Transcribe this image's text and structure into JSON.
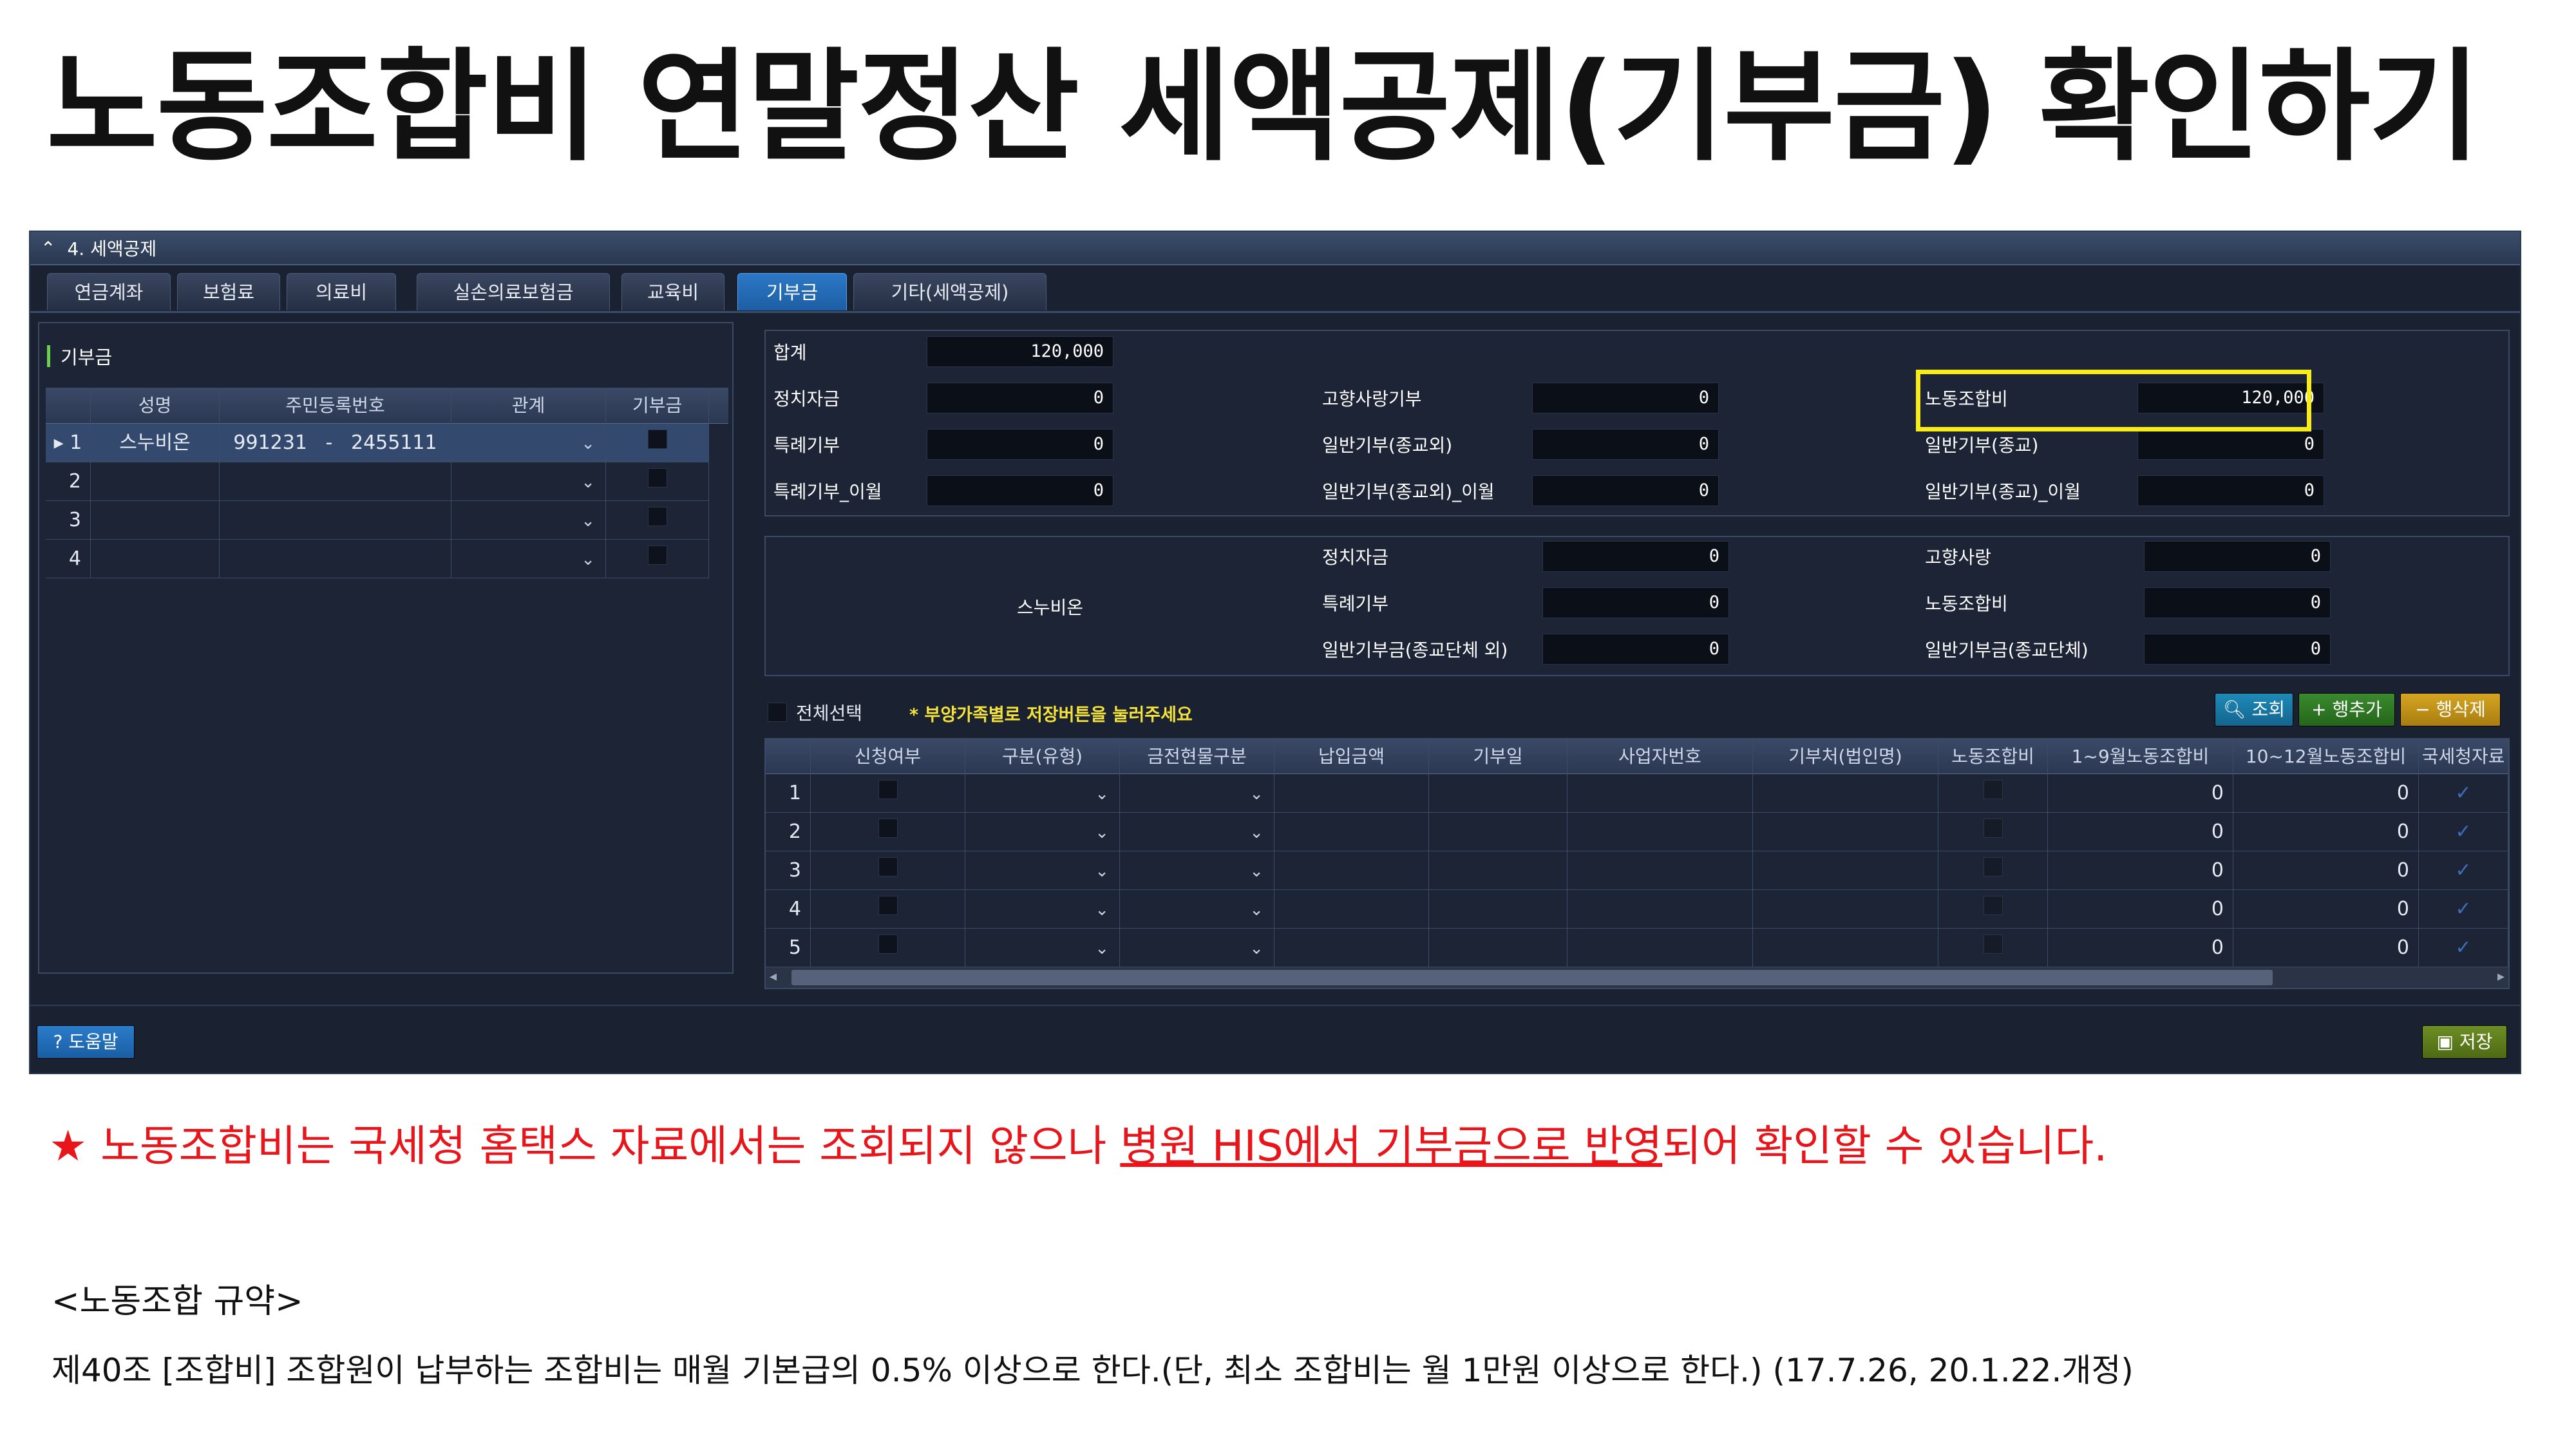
{
  "title": "노동조합비 연말정산 세액공제(기부금) 확인하기",
  "section": {
    "label": "4. 세액공제"
  },
  "tabs": [
    "연금계좌",
    "보험료",
    "의료비",
    "실손의료보험금",
    "교육비",
    "기부금",
    "기타(세액공제)"
  ],
  "left": {
    "title": "기부금",
    "columns": [
      "성명",
      "주민등록번호",
      "관계",
      "기부금"
    ],
    "rows": [
      {
        "num": "1",
        "name": "스누비온",
        "rrn1": "991231",
        "dash": "-",
        "rrn2": "2455111"
      },
      {
        "num": "2"
      },
      {
        "num": "3"
      },
      {
        "num": "4"
      }
    ]
  },
  "summary": {
    "total_label": "합계",
    "total": "120,000",
    "col1": [
      {
        "label": "정치자금",
        "value": "0"
      },
      {
        "label": "특례기부",
        "value": "0"
      },
      {
        "label": "특례기부_이월",
        "value": "0"
      }
    ],
    "col2": [
      {
        "label": "고향사랑기부",
        "value": "0"
      },
      {
        "label": "일반기부(종교외)",
        "value": "0"
      },
      {
        "label": "일반기부(종교외)_이월",
        "value": "0"
      }
    ],
    "col3": [
      {
        "label": "노동조합비",
        "value": "120,000"
      },
      {
        "label": "일반기부(종교)",
        "value": "0"
      },
      {
        "label": "일반기부(종교)_이월",
        "value": "0"
      }
    ]
  },
  "person": {
    "name": "스누비온",
    "col1": [
      {
        "label": "정치자금",
        "value": "0"
      },
      {
        "label": "특례기부",
        "value": "0"
      },
      {
        "label": "일반기부금(종교단체 외)",
        "value": "0"
      }
    ],
    "col2": [
      {
        "label": "고향사랑",
        "value": "0"
      },
      {
        "label": "노동조합비",
        "value": "0"
      },
      {
        "label": "일반기부금(종교단체)",
        "value": "0"
      }
    ]
  },
  "toolbar": {
    "select_all": "전체선택",
    "notice": "* 부양가족별로 저장버튼을 눌러주세요",
    "query": "조회",
    "add_row": "행추가",
    "delete_row": "행삭제"
  },
  "detail": {
    "columns": [
      "신청여부",
      "구분(유형)",
      "금전현물구분",
      "납입금액",
      "기부일",
      "사업자번호",
      "기부처(법인명)",
      "노동조합비",
      "1~9월노동조합비",
      "10~12월노동조합비",
      "국세청자료"
    ],
    "rows": [
      {
        "num": "1",
        "v1": "0",
        "v2": "0"
      },
      {
        "num": "2",
        "v1": "0",
        "v2": "0"
      },
      {
        "num": "3",
        "v1": "0",
        "v2": "0"
      },
      {
        "num": "4",
        "v1": "0",
        "v2": "0"
      },
      {
        "num": "5",
        "v1": "0",
        "v2": "0"
      }
    ]
  },
  "footer": {
    "help": "도움말",
    "save": "저장"
  },
  "note": {
    "prefix": "★ 노동조합비는 국세청 홈택스 자료에서는 조회되지 않으나 ",
    "underlined": "병원 HIS에서 기부금으로 반영",
    "suffix": "되어 확인할 수 있습니다."
  },
  "bylaw": {
    "heading": "<노동조합 규약>",
    "text": "제40조 [조합비] 조합원이 납부하는 조합비는 매월 기본급의 0.5% 이상으로 한다.(단, 최소 조합비는 월 1만원 이상으로 한다.) (17.7.26, 20.1.22.개정)"
  },
  "colors": {
    "highlight": "#f7ec17",
    "note_red": "#e8151b",
    "active_tab": "#2c78c6"
  }
}
